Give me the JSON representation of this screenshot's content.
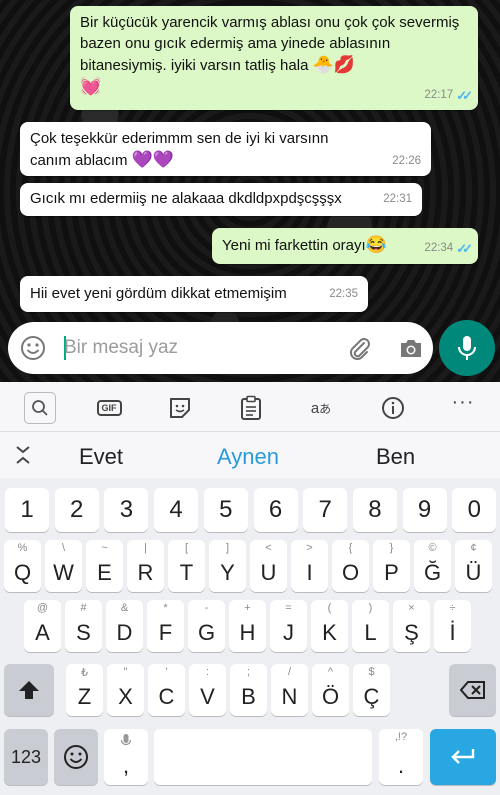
{
  "messages": [
    {
      "dir": "out",
      "text": "Bir küçücük yarencik varmış ablası onu çok çok severmiş bazen onu gıcık edermiş ama yinede ablasının bitanesiymiş. iyiki varsın tatliş hala",
      "emojis": "🐣💋",
      "emoji_line2": "💓",
      "time": "22:17",
      "read": true
    },
    {
      "dir": "in",
      "text": "Çok teşekkür ederimmm sen de iyi ki varsınn canım ablacım",
      "emojis": "💜💜",
      "time": "22:26"
    },
    {
      "dir": "in",
      "text": "Gıcık mı edermiiş ne alakaaa dkdldpxpdşcşşşx",
      "time": "22:31"
    },
    {
      "dir": "out",
      "text": "Yeni mi farkettin orayı",
      "emojis": "😂",
      "time": "22:34",
      "read": true
    },
    {
      "dir": "in",
      "text": "Hii evet yeni gördüm dikkat etmemişim",
      "time": "22:35"
    }
  ],
  "composer": {
    "placeholder": "Bir mesaj yaz"
  },
  "keyboard": {
    "suggestions": [
      "Evet",
      "Aynen",
      "Ben"
    ],
    "row_numbers": [
      "1",
      "2",
      "3",
      "4",
      "5",
      "6",
      "7",
      "8",
      "9",
      "0"
    ],
    "row1": [
      [
        "%",
        "Q"
      ],
      [
        "\\",
        "W"
      ],
      [
        "~",
        "E"
      ],
      [
        "|",
        "R"
      ],
      [
        "[",
        "T"
      ],
      [
        "]",
        "Y"
      ],
      [
        "<",
        "U"
      ],
      [
        ">",
        "I"
      ],
      [
        "{",
        "O"
      ],
      [
        "}",
        "P"
      ],
      [
        "©",
        "Ğ"
      ],
      [
        "¢",
        "Ü"
      ]
    ],
    "row2": [
      [
        "@",
        "A"
      ],
      [
        "#",
        "S"
      ],
      [
        "&",
        "D"
      ],
      [
        "*",
        "F"
      ],
      [
        "-",
        "G"
      ],
      [
        "+",
        "H"
      ],
      [
        "=",
        "J"
      ],
      [
        "(",
        "K"
      ],
      [
        ")",
        "L"
      ],
      [
        "×",
        "Ş"
      ],
      [
        "÷",
        "İ"
      ]
    ],
    "row3": [
      [
        "₺",
        "Z"
      ],
      [
        "\"",
        "X"
      ],
      [
        "'",
        "C"
      ],
      [
        ":",
        "V"
      ],
      [
        ";",
        "B"
      ],
      [
        "/",
        "N"
      ],
      [
        "^",
        "Ö"
      ],
      [
        "$",
        "Ç"
      ]
    ],
    "bottom": {
      "numbers_label": "123",
      "comma": ",",
      "period": ".",
      "period_alt": ",!?"
    }
  },
  "colors": {
    "outgoing": "#dcf8c6",
    "incoming": "#ffffff",
    "read_ticks": "#4fb6ec",
    "accent": "#00897b",
    "suggestion_highlight": "#2a9ad8",
    "enter": "#29a7e3"
  }
}
